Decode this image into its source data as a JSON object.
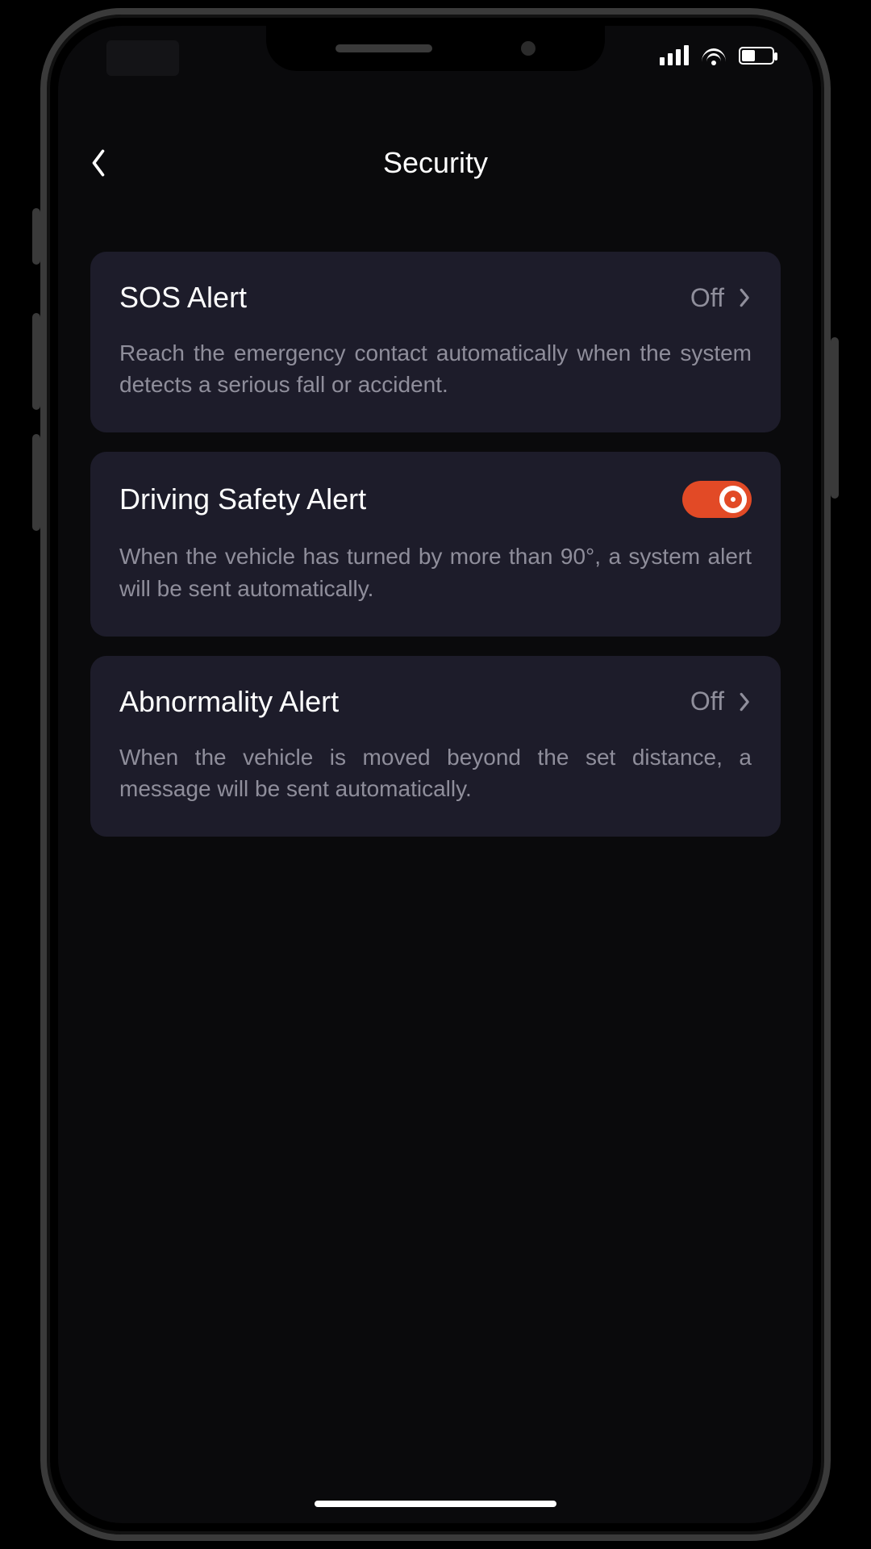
{
  "header": {
    "title": "Security"
  },
  "cards": {
    "sos": {
      "label": "SOS Alert",
      "value": "Off",
      "desc": "Reach the emergency contact automatically when the system detects a serious fall or accident."
    },
    "driving": {
      "label": "Driving Safety Alert",
      "toggle_on": true,
      "desc": "When the vehicle has turned by more than 90°, a system alert will be sent automatically."
    },
    "abnormality": {
      "label": "Abnormality Alert",
      "value": "Off",
      "desc": "When the vehicle is moved beyond the set distance, a message will be sent automatically."
    }
  },
  "colors": {
    "card_bg": "#1d1c2a",
    "accent": "#e24a26",
    "text_secondary": "#8f8e9b"
  }
}
